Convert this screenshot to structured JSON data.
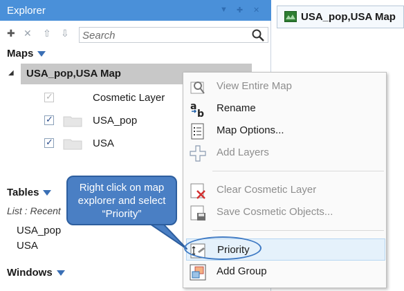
{
  "explorer": {
    "title": "Explorer",
    "search_placeholder": "Search",
    "maps_label": "Maps",
    "map_name": "USA_pop,USA Map",
    "layers": [
      {
        "name": "Cosmetic Layer",
        "checked": true,
        "disabled": true
      },
      {
        "name": "USA_pop",
        "checked": true,
        "disabled": false
      },
      {
        "name": "USA",
        "checked": true,
        "disabled": false
      }
    ],
    "tables_label": "Tables",
    "tables_list_label": "List : Recent",
    "tables": [
      "USA_pop",
      "USA"
    ],
    "windows_label": "Windows",
    "icons": [
      "add-icon",
      "remove-icon",
      "move-up-icon",
      "move-down-icon",
      "search-icon"
    ]
  },
  "map_tab": {
    "title": "USA_pop,USA Map",
    "icon": "map-window-icon"
  },
  "context_menu": {
    "items": [
      {
        "label": "View Entire Map",
        "disabled": true,
        "icon": "view-entire-map-icon"
      },
      {
        "label": "Rename",
        "disabled": false,
        "icon": "rename-icon"
      },
      {
        "label": "Map Options...",
        "disabled": false,
        "icon": "map-options-icon"
      },
      {
        "label": "Add Layers",
        "disabled": true,
        "icon": "add-layers-icon"
      },
      {
        "label": "Clear Cosmetic Layer",
        "disabled": true,
        "icon": "clear-cosmetic-icon"
      },
      {
        "label": "Save Cosmetic Objects...",
        "disabled": true,
        "icon": "save-cosmetic-icon"
      },
      {
        "label": "Priority",
        "disabled": false,
        "highlighted": true,
        "icon": "priority-icon"
      },
      {
        "label": "Add Group",
        "disabled": false,
        "icon": "add-group-icon"
      }
    ]
  },
  "callout": {
    "line1": "Right click on map",
    "line2": "explorer and select",
    "line3": "“Priority”"
  },
  "colors": {
    "titlebar": "#4a90d9",
    "selection": "#c8c8c8",
    "callout": "#4a7fc4",
    "menu_highlight": "#e5f1fb"
  }
}
